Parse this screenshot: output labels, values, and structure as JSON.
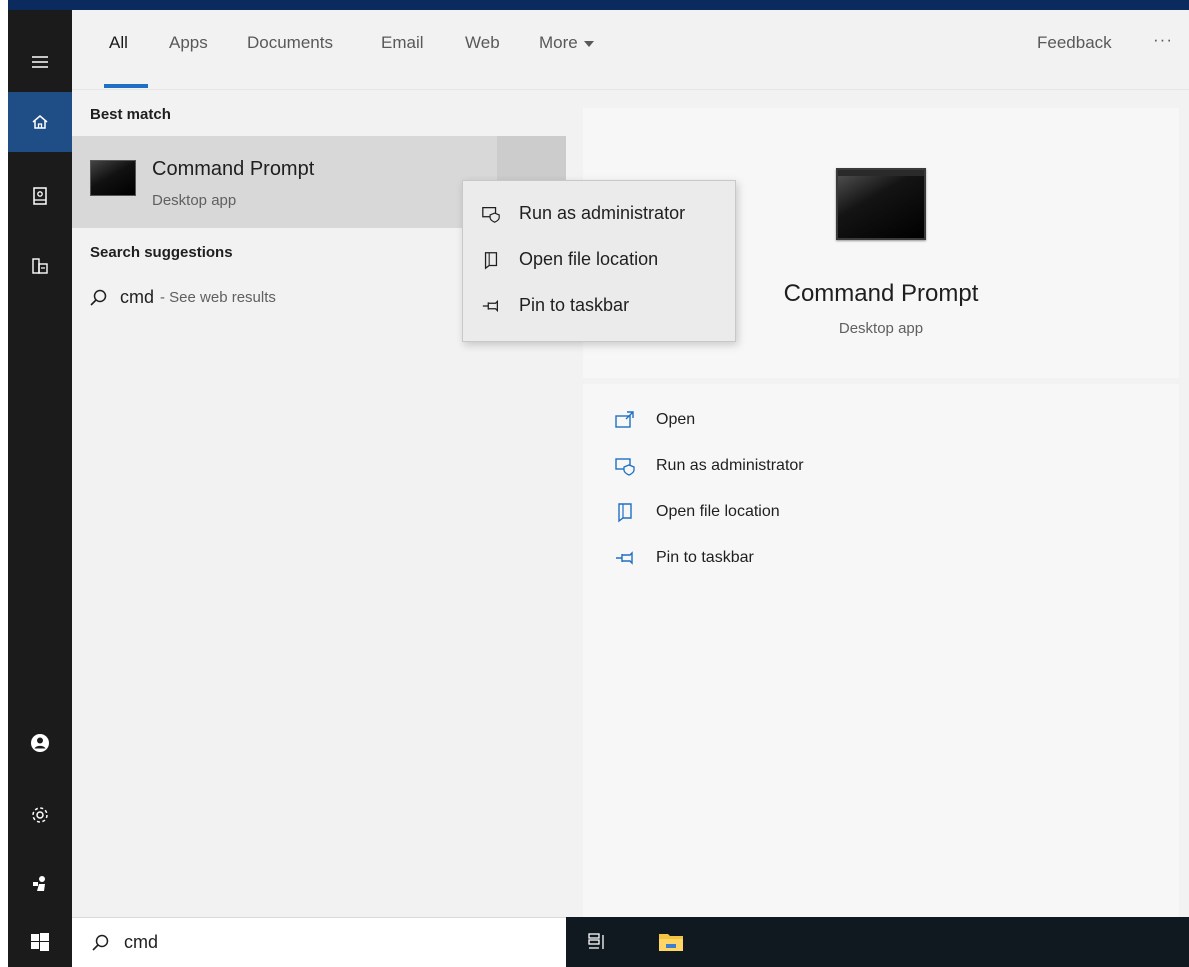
{
  "tabs": {
    "items": [
      "All",
      "Apps",
      "Documents",
      "Email",
      "Web",
      "More"
    ],
    "active": "All",
    "feedback": "Feedback",
    "overflow": "···"
  },
  "left": {
    "best_match_label": "Best match",
    "best_match": {
      "title": "Command Prompt",
      "subtitle": "Desktop app"
    },
    "suggestions_label": "Search suggestions",
    "suggestion": {
      "term": "cmd",
      "hint": "- See web results"
    }
  },
  "context_menu": {
    "items": [
      {
        "label": "Run as administrator",
        "icon": "shield-run-icon"
      },
      {
        "label": "Open file location",
        "icon": "file-location-icon"
      },
      {
        "label": "Pin to taskbar",
        "icon": "pin-icon"
      }
    ]
  },
  "preview": {
    "title": "Command Prompt",
    "subtitle": "Desktop app",
    "actions": [
      {
        "label": "Open",
        "icon": "open-icon"
      },
      {
        "label": "Run as administrator",
        "icon": "shield-run-icon"
      },
      {
        "label": "Open file location",
        "icon": "file-location-icon"
      },
      {
        "label": "Pin to taskbar",
        "icon": "pin-icon"
      }
    ]
  },
  "search": {
    "value": "cmd"
  },
  "rail": {
    "icons": [
      "hamburger-icon",
      "home-icon",
      "notebook-icon",
      "documents-icon",
      "account-icon",
      "settings-icon",
      "feedback-person-icon"
    ]
  },
  "colors": {
    "accent": "#1f6fc5",
    "rail_bg": "#1b1b1b",
    "rail_active": "#1f4e86",
    "taskbar": "#101820"
  }
}
